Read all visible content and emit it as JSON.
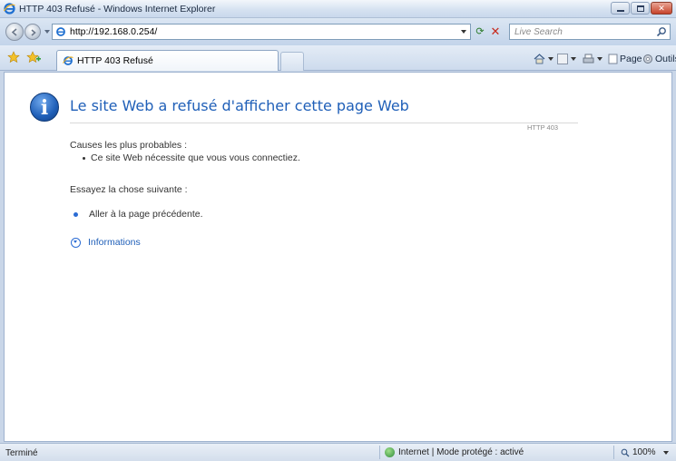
{
  "window": {
    "title": "HTTP 403 Refusé - Windows Internet Explorer"
  },
  "navigation": {
    "address_url": "http://192.168.0.254/",
    "search_placeholder": "Live Search"
  },
  "tabs": [
    {
      "title": "HTTP 403 Refusé"
    }
  ],
  "command_bar": {
    "page_label": "Page",
    "tools_label": "Outils"
  },
  "error_page": {
    "heading": "Le site Web a refusé d'afficher cette page Web",
    "code": "HTTP 403",
    "causes_label": "Causes les plus probables :",
    "causes": [
      "Ce site Web nécessite que vous vous connectiez."
    ],
    "try_label": "Essayez la chose suivante :",
    "go_back_link": "Aller à la page précédente.",
    "more_info_link": "Informations"
  },
  "status_bar": {
    "status_text": "Terminé",
    "zone_text": "Internet | Mode protégé : activé",
    "zoom": "100%"
  },
  "colors": {
    "link_blue": "#1f5fb8",
    "chrome_blue": "#c9d6e8"
  }
}
